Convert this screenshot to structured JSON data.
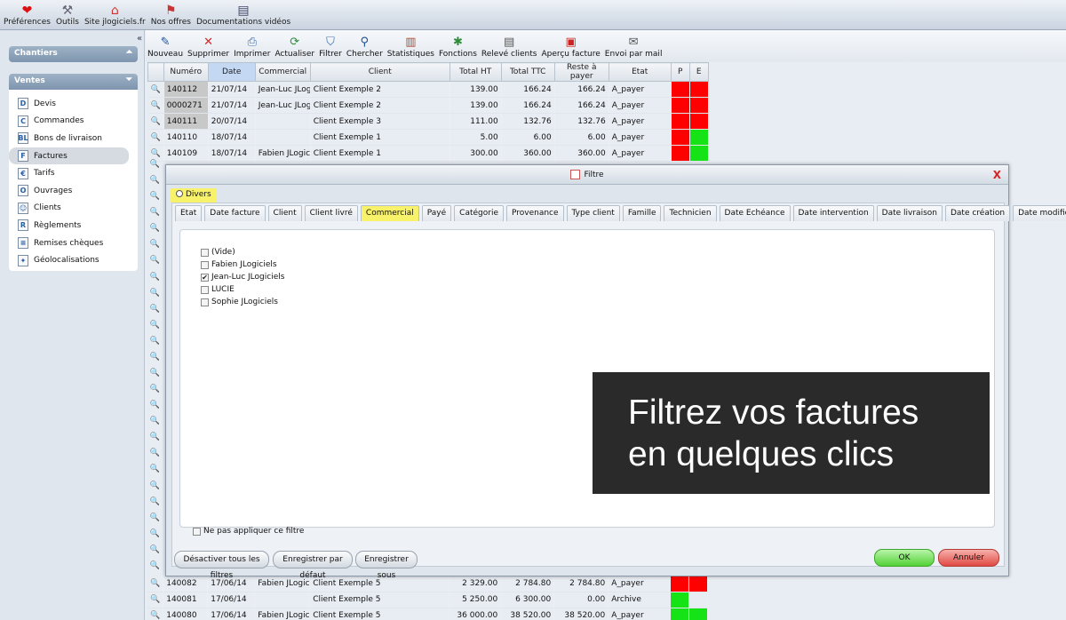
{
  "topbar": {
    "items": [
      {
        "label": "Préférences",
        "icon": "heart-icon"
      },
      {
        "label": "Outils",
        "icon": "tools-icon"
      },
      {
        "label": "Site jlogiciels.fr",
        "icon": "website-icon"
      },
      {
        "label": "Nos offres",
        "icon": "offers-icon"
      },
      {
        "label": "Documentations vidéos",
        "icon": "video-doc-icon"
      }
    ]
  },
  "sidebar": {
    "chantiers_title": "Chantiers",
    "ventes_title": "Ventes",
    "items": [
      {
        "label": "Devis",
        "letter": "D"
      },
      {
        "label": "Commandes",
        "letter": "C"
      },
      {
        "label": "Bons de livraison",
        "letter": "BL"
      },
      {
        "label": "Factures",
        "letter": "F"
      },
      {
        "label": "Tarifs",
        "letter": "€"
      },
      {
        "label": "Ouvrages",
        "letter": "O"
      },
      {
        "label": "Clients",
        "letter": "☺"
      },
      {
        "label": "Règlements",
        "letter": "R"
      },
      {
        "label": "Remises chèques",
        "letter": "≡"
      },
      {
        "label": "Géolocalisations",
        "letter": "✦"
      }
    ],
    "collapse": "«"
  },
  "toolbar": {
    "items": [
      {
        "label": "Nouveau",
        "icon": "new-icon",
        "glyph": "✎"
      },
      {
        "label": "Supprimer",
        "icon": "delete-icon",
        "glyph": "✕"
      },
      {
        "label": "Imprimer",
        "icon": "print-icon",
        "glyph": "⎙"
      },
      {
        "label": "Actualiser",
        "icon": "refresh-icon",
        "glyph": "⟳"
      },
      {
        "label": "Filtrer",
        "icon": "filter-icon",
        "glyph": "⛉"
      },
      {
        "label": "Chercher",
        "icon": "search-icon",
        "glyph": "⚲"
      },
      {
        "label": "Statistiques",
        "icon": "stats-icon",
        "glyph": "▥"
      },
      {
        "label": "Fonctions",
        "icon": "functions-icon",
        "glyph": "✱"
      },
      {
        "label": "Relevé clients",
        "icon": "statement-icon",
        "glyph": "▤"
      },
      {
        "label": "Aperçu facture",
        "icon": "preview-icon",
        "glyph": "▣"
      },
      {
        "label": "Envoi par mail",
        "icon": "mail-icon",
        "glyph": "✉"
      }
    ]
  },
  "grid": {
    "columns": [
      "Numéro",
      "Date",
      "Commercial",
      "Client",
      "Total HT",
      "Total TTC",
      "Reste à payer",
      "Etat",
      "P",
      "E"
    ],
    "rows_top": [
      {
        "num": "140112",
        "date": "21/07/14",
        "com": "Jean-Luc JLogi",
        "client": "Client Exemple 2",
        "ht": "139.00",
        "ttc": "166.24",
        "rap": "166.24",
        "etat": "A_payer",
        "p": "red",
        "e": "red",
        "hl": true
      },
      {
        "num": "0000271",
        "date": "21/07/14",
        "com": "Jean-Luc JLogi",
        "client": "Client Exemple 2",
        "ht": "139.00",
        "ttc": "166.24",
        "rap": "166.24",
        "etat": "A_payer",
        "p": "red",
        "e": "red",
        "hl": true
      },
      {
        "num": "140111",
        "date": "20/07/14",
        "com": "",
        "client": "Client Exemple 3",
        "ht": "111.00",
        "ttc": "132.76",
        "rap": "132.76",
        "etat": "A_payer",
        "p": "red",
        "e": "red",
        "hl": true
      },
      {
        "num": "140110",
        "date": "18/07/14",
        "com": "",
        "client": "Client Exemple 1",
        "ht": "5.00",
        "ttc": "6.00",
        "rap": "6.00",
        "etat": "A_payer",
        "p": "red",
        "e": "green",
        "hl": false
      },
      {
        "num": "140109",
        "date": "18/07/14",
        "com": "Fabien JLogici",
        "client": "Client Exemple 1",
        "ht": "300.00",
        "ttc": "360.00",
        "rap": "360.00",
        "etat": "A_payer",
        "p": "red",
        "e": "green",
        "hl": false
      }
    ],
    "rows_bottom": [
      {
        "num": "140082",
        "date": "17/06/14",
        "com": "Fabien JLogici",
        "client": "Client Exemple 5",
        "ht": "2 329.00",
        "ttc": "2 784.80",
        "rap": "2 784.80",
        "etat": "A_payer",
        "p": "red",
        "e": "red"
      },
      {
        "num": "140081",
        "date": "17/06/14",
        "com": "",
        "client": "Client Exemple 5",
        "ht": "5 250.00",
        "ttc": "6 300.00",
        "rap": "0.00",
        "etat": "Archive",
        "p": "green",
        "e": "white"
      },
      {
        "num": "140080",
        "date": "17/06/14",
        "com": "Fabien JLogici",
        "client": "Client Exemple 5",
        "ht": "36 000.00",
        "ttc": "38 520.00",
        "rap": "38 520.00",
        "etat": "A_payer",
        "p": "green",
        "e": "green"
      }
    ]
  },
  "dialog": {
    "title": "Filtre",
    "close": "X",
    "divers": "Divers",
    "tabs": [
      "Etat",
      "Date facture",
      "Client",
      "Client livré",
      "Commercial",
      "Payé",
      "Catégorie",
      "Provenance",
      "Type client",
      "Famille",
      "Technicien",
      "Date Echéance",
      "Date intervention",
      "Date livraison",
      "Date création",
      "Date modification"
    ],
    "active_tab": "Commercial",
    "options": [
      {
        "label": "(Vide)",
        "checked": false
      },
      {
        "label": "Fabien JLogiciels",
        "checked": false
      },
      {
        "label": "Jean-Luc JLogiciels",
        "checked": true
      },
      {
        "label": "LUCIE",
        "checked": false
      },
      {
        "label": "Sophie JLogiciels",
        "checked": false
      }
    ],
    "no_apply": "Ne pas appliquer ce filtre",
    "buttons": {
      "deactivate": "Désactiver tous les filtres",
      "save_default": "Enregistrer par défaut",
      "save_as": "Enregistrer sous",
      "ok": "OK",
      "cancel": "Annuler"
    }
  },
  "promo": {
    "line1": "Filtrez vos factures",
    "line2": "en quelques clics"
  }
}
